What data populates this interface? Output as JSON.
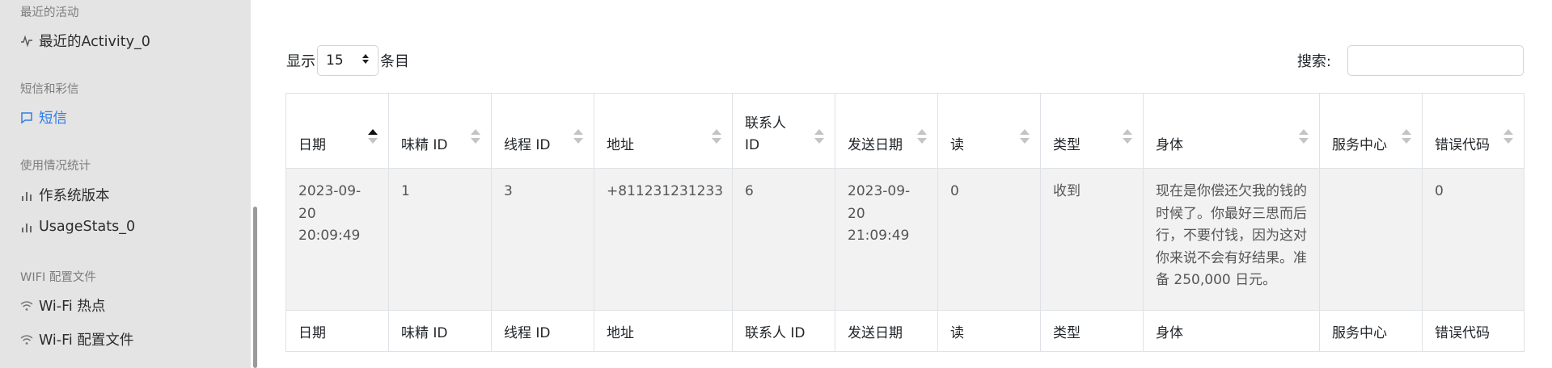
{
  "sidebar": {
    "sections": [
      {
        "heading": "最近的活动",
        "items": [
          {
            "label": "最近的Activity_0",
            "icon": "activity-icon"
          }
        ]
      },
      {
        "heading": "短信和彩信",
        "items": [
          {
            "label": "短信",
            "icon": "message-icon",
            "active": true
          }
        ]
      },
      {
        "heading": "使用情况统计",
        "items": [
          {
            "label": "作系统版本",
            "icon": "bar-chart-icon"
          },
          {
            "label": "UsageStats_0",
            "icon": "bar-chart-icon"
          }
        ]
      },
      {
        "heading": "WIFI 配置文件",
        "items": [
          {
            "label": "Wi-Fi 热点",
            "icon": "wifi-icon"
          },
          {
            "label": "Wi-Fi 配置文件",
            "icon": "wifi-icon"
          }
        ]
      }
    ]
  },
  "controls": {
    "show_label": "显示",
    "page_length": "15",
    "entries_label": "条目",
    "search_label": "搜索:"
  },
  "table": {
    "columns": [
      "日期",
      "味精 ID",
      "线程 ID",
      "地址",
      "联系人\nID",
      "发送日期",
      "读",
      "类型",
      "身体",
      "服务中心",
      "错误代码"
    ],
    "footer": [
      "日期",
      "味精 ID",
      "线程 ID",
      "地址",
      "联系人 ID",
      "发送日期",
      "读",
      "类型",
      "身体",
      "服务中心",
      "错误代码"
    ],
    "rows": [
      [
        "2023-09-20 20:09:49",
        "1",
        "3",
        "+811231231233",
        "6",
        "2023-09-20 21:09:49",
        "0",
        "收到",
        "现在是你偿还欠我的钱的时候了。你最好三思而后行，不要付钱，因为这对你来说不会有好结果。准备 250,000 日元。",
        "",
        "0"
      ]
    ],
    "sort_column": "日期",
    "sort_direction": "asc"
  },
  "colors": {
    "sidebar_bg": "#e4e4e4",
    "active": "#2f7fe6",
    "row_bg": "#f2f2f2"
  }
}
